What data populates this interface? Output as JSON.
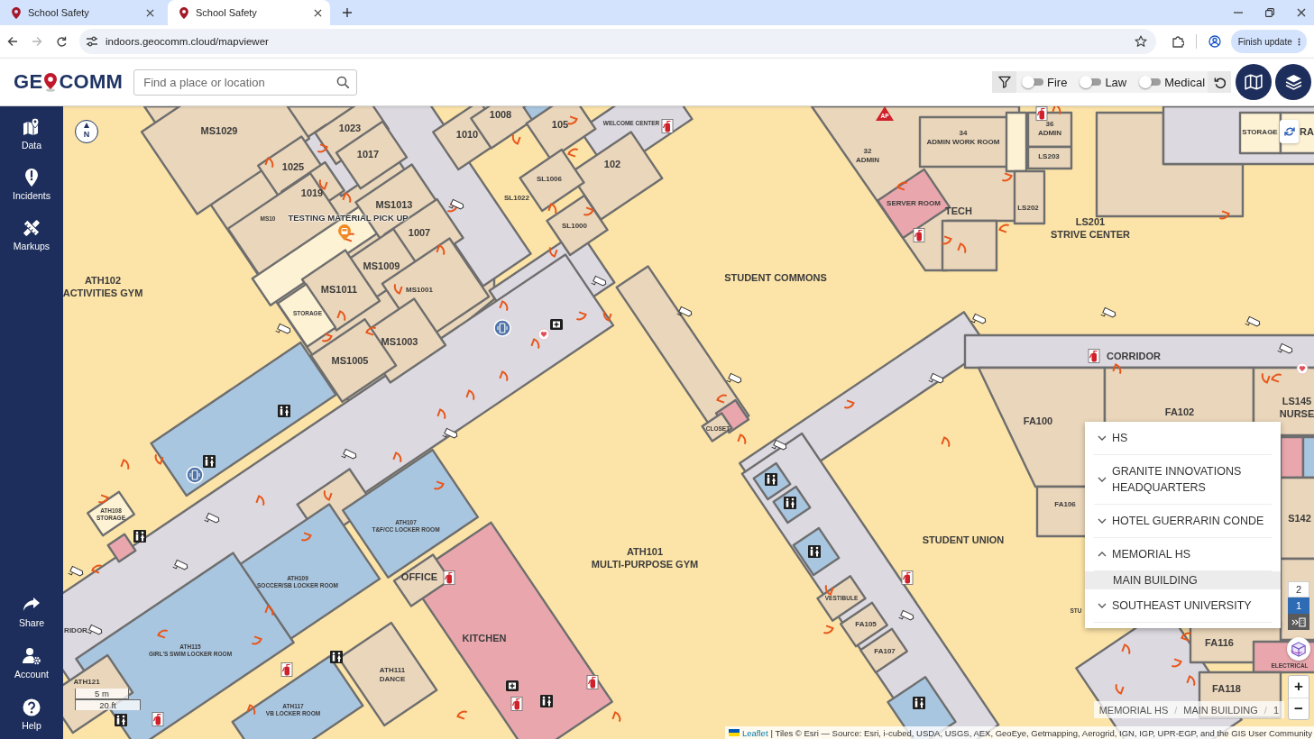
{
  "browser": {
    "tabs": [
      {
        "title": "School Safety",
        "selected": false
      },
      {
        "title": "School Safety",
        "selected": true
      }
    ],
    "forward_disabled": true,
    "url": "indoors.geocomm.cloud/mapviewer",
    "update_button": "Finish update"
  },
  "header": {
    "logo": {
      "left": "GE",
      "right": "COMM"
    },
    "search": {
      "placeholder": "Find a place or location"
    },
    "filters": [
      {
        "label": "Fire",
        "on": false
      },
      {
        "label": "Law",
        "on": false
      },
      {
        "label": "Medical",
        "on": false
      }
    ]
  },
  "sidebar": {
    "top_items": [
      {
        "label": "Data"
      },
      {
        "label": "Incidents"
      },
      {
        "label": "Markups"
      }
    ],
    "bottom_items": [
      {
        "label": "Share"
      },
      {
        "label": "Account"
      },
      {
        "label": "Help"
      }
    ]
  },
  "map": {
    "north_label": "N",
    "marker_label": "AP",
    "poi_label": "TESTING MATERIAL PICK UP",
    "room_labels": [
      {
        "lines": [
          "MS1029"
        ],
        "kind": "normal"
      },
      {
        "lines": [
          "1023"
        ],
        "kind": "normal"
      },
      {
        "lines": [
          "1010"
        ],
        "kind": "normal"
      },
      {
        "lines": [
          "1008"
        ],
        "kind": "normal"
      },
      {
        "lines": [
          "105"
        ],
        "kind": "normal"
      },
      {
        "lines": [
          "WELCOME CENTER"
        ],
        "kind": "tiny"
      },
      {
        "lines": [
          "34",
          "ADMIN WORK ROOM"
        ],
        "kind": "small"
      },
      {
        "lines": [
          "36",
          "ADMIN"
        ],
        "kind": "small"
      },
      {
        "lines": [
          "STORAGE"
        ],
        "kind": "small"
      },
      {
        "lines": [
          "RA"
        ],
        "kind": "normal"
      },
      {
        "lines": [
          "1025"
        ],
        "kind": "normal"
      },
      {
        "lines": [
          "1017"
        ],
        "kind": "normal"
      },
      {
        "lines": [
          "SL1006"
        ],
        "kind": "small"
      },
      {
        "lines": [
          "102"
        ],
        "kind": "normal"
      },
      {
        "lines": [
          "32",
          "ADMIN"
        ],
        "kind": "small"
      },
      {
        "lines": [
          "LS203"
        ],
        "kind": "small"
      },
      {
        "lines": [
          "MS10"
        ],
        "kind": "tiny"
      },
      {
        "lines": [
          "1019"
        ],
        "kind": "normal"
      },
      {
        "lines": [
          "MS1013"
        ],
        "kind": "normal"
      },
      {
        "lines": [
          "1007"
        ],
        "kind": "normal"
      },
      {
        "lines": [
          "SL1022"
        ],
        "kind": "small"
      },
      {
        "lines": [
          "SL1000"
        ],
        "kind": "small"
      },
      {
        "lines": [
          "SERVER ROOM"
        ],
        "kind": "small"
      },
      {
        "lines": [
          "TECH"
        ],
        "kind": "normal"
      },
      {
        "lines": [
          "LS202"
        ],
        "kind": "small"
      },
      {
        "lines": [
          "LS201",
          "STRIVE CENTER"
        ],
        "kind": "normal"
      },
      {
        "lines": [
          "ATH102",
          "ACTIVITIES GYM"
        ],
        "kind": "normal"
      },
      {
        "lines": [
          "MS1011"
        ],
        "kind": "normal"
      },
      {
        "lines": [
          "MS1009"
        ],
        "kind": "normal"
      },
      {
        "lines": [
          "MS1001"
        ],
        "kind": "small"
      },
      {
        "lines": [
          "STUDENT COMMONS"
        ],
        "kind": "normal"
      },
      {
        "lines": [
          "STORAGE"
        ],
        "kind": "tiny"
      },
      {
        "lines": [
          "MS1003"
        ],
        "kind": "normal"
      },
      {
        "lines": [
          "MS1005"
        ],
        "kind": "normal"
      },
      {
        "lines": [
          "CORRIDOR"
        ],
        "kind": "normal"
      },
      {
        "lines": [
          "CLOSET"
        ],
        "kind": "tiny"
      },
      {
        "lines": [
          "FA100"
        ],
        "kind": "normal"
      },
      {
        "lines": [
          "FA102"
        ],
        "kind": "normal"
      },
      {
        "lines": [
          "LS145",
          "NURSE"
        ],
        "kind": "normal"
      },
      {
        "lines": [
          "ATH108",
          "STORAGE"
        ],
        "kind": "tiny"
      },
      {
        "lines": [
          "ATH107",
          "T&F/CC LOCKER ROOM"
        ],
        "kind": "tiny"
      },
      {
        "lines": [
          "STUDENT UNION"
        ],
        "kind": "normal"
      },
      {
        "lines": [
          "FA106"
        ],
        "kind": "small"
      },
      {
        "lines": [
          "S142"
        ],
        "kind": "normal"
      },
      {
        "lines": [
          "ATH109",
          "SOCCER/SB LOCKER ROOM"
        ],
        "kind": "tiny"
      },
      {
        "lines": [
          "OFFICE"
        ],
        "kind": "normal"
      },
      {
        "lines": [
          "ATH101",
          "MULTI-PURPOSE GYM"
        ],
        "kind": "normal"
      },
      {
        "lines": [
          "VESTIBULE"
        ],
        "kind": "tiny"
      },
      {
        "lines": [
          "STU"
        ],
        "kind": "tiny"
      },
      {
        "lines": [
          "RIDOR"
        ],
        "kind": "small"
      },
      {
        "lines": [
          "ATH115",
          "GIRL'S SWIM LOCKER ROOM"
        ],
        "kind": "tiny"
      },
      {
        "lines": [
          "KITCHEN"
        ],
        "kind": "normal"
      },
      {
        "lines": [
          "FA105"
        ],
        "kind": "small"
      },
      {
        "lines": [
          "FA107"
        ],
        "kind": "small"
      },
      {
        "lines": [
          "FA116"
        ],
        "kind": "normal"
      },
      {
        "lines": [
          "ATH121"
        ],
        "kind": "small"
      },
      {
        "lines": [
          "ATH111",
          "DANCE"
        ],
        "kind": "small"
      },
      {
        "lines": [
          "FA118"
        ],
        "kind": "normal"
      },
      {
        "lines": [
          "ELECTRICAL"
        ],
        "kind": "tiny"
      },
      {
        "lines": [
          "ATH117",
          "VB LOCKER ROOM"
        ],
        "kind": "tiny"
      }
    ],
    "scale": {
      "metric": "5 m",
      "imperial": "20 ft"
    },
    "floors": [
      {
        "label": "2",
        "selected": false
      },
      {
        "label": "1",
        "selected": true
      }
    ],
    "zoom_in": "+",
    "zoom_out": "−",
    "breadcrumb": {
      "items": [
        "MEMORIAL HS",
        "MAIN BUILDING",
        "1"
      ],
      "separators": [
        "/",
        "/"
      ]
    },
    "attribution": {
      "link": "Leaflet",
      "text": "| Tiles © Esri — Source: Esri, i-cubed, USDA, USGS, AEX, GeoEye, Getmapping, Aerogrid, IGN, IGP, UPR-EGP, and the GIS User Community"
    }
  },
  "building_menu": {
    "items": [
      {
        "label": "HS",
        "expanded": false
      },
      {
        "label": "GRANITE INNOVATIONS HEADQUARTERS",
        "expanded": false
      },
      {
        "label": "HOTEL GUERRARIN CONDE",
        "expanded": false
      },
      {
        "label": "MEMORIAL HS",
        "expanded": true,
        "children": [
          {
            "label": "MAIN BUILDING",
            "selected": true
          }
        ]
      },
      {
        "label": "SOUTHEAST UNIVERSITY",
        "expanded": false
      }
    ]
  }
}
